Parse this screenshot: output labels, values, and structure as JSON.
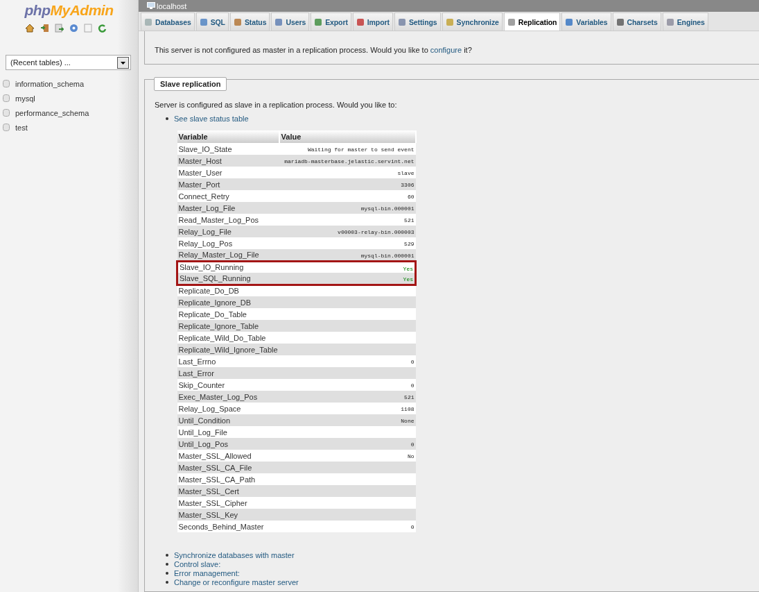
{
  "sidebar": {
    "logo": {
      "part1": "php",
      "part2": "MyAdmin"
    },
    "recent_tables": "(Recent tables) ...",
    "databases": [
      "information_schema",
      "mysql",
      "performance_schema",
      "test"
    ]
  },
  "server": "localhost",
  "tabs": [
    {
      "label": "Databases",
      "selected": false
    },
    {
      "label": "SQL",
      "selected": false
    },
    {
      "label": "Status",
      "selected": false
    },
    {
      "label": "Users",
      "selected": false
    },
    {
      "label": "Export",
      "selected": false
    },
    {
      "label": "Import",
      "selected": false
    },
    {
      "label": "Settings",
      "selected": false
    },
    {
      "label": "Synchronize",
      "selected": false
    },
    {
      "label": "Replication",
      "selected": true
    },
    {
      "label": "Variables",
      "selected": false
    },
    {
      "label": "Charsets",
      "selected": false
    },
    {
      "label": "Engines",
      "selected": false
    }
  ],
  "master": {
    "text": "This server is not configured as master in a replication process. Would you like to ",
    "link": "configure",
    "after": " it?"
  },
  "slave": {
    "legend": "Slave replication",
    "intro": "Server is configured as slave in a replication process. Would you like to:",
    "status_link": "See slave status table",
    "table": {
      "columns": [
        "Variable",
        "Value"
      ],
      "rows": [
        {
          "variable": "Slave_IO_State",
          "value": "Waiting for master to send event",
          "highlighted": false
        },
        {
          "variable": "Master_Host",
          "value": "mariadb-masterbase.jelastic.servint.net",
          "highlighted": false
        },
        {
          "variable": "Master_User",
          "value": "slave",
          "highlighted": false
        },
        {
          "variable": "Master_Port",
          "value": "3306",
          "highlighted": false
        },
        {
          "variable": "Connect_Retry",
          "value": "60",
          "highlighted": false
        },
        {
          "variable": "Master_Log_File",
          "value": "mysql-bin.000001",
          "highlighted": false
        },
        {
          "variable": "Read_Master_Log_Pos",
          "value": "521",
          "highlighted": false
        },
        {
          "variable": "Relay_Log_File",
          "value": "v00003-relay-bin.000003",
          "highlighted": false
        },
        {
          "variable": "Relay_Log_Pos",
          "value": "529",
          "highlighted": false
        },
        {
          "variable": "Relay_Master_Log_File",
          "value": "mysql-bin.000001",
          "highlighted": false
        },
        {
          "variable": "Slave_IO_Running",
          "value": "Yes",
          "highlighted": true
        },
        {
          "variable": "Slave_SQL_Running",
          "value": "Yes",
          "highlighted": true
        },
        {
          "variable": "Replicate_Do_DB",
          "highlighted": false
        },
        {
          "variable": "Replicate_Ignore_DB",
          "highlighted": false
        },
        {
          "variable": "Replicate_Do_Table",
          "highlighted": false
        },
        {
          "variable": "Replicate_Ignore_Table",
          "highlighted": false
        },
        {
          "variable": "Replicate_Wild_Do_Table",
          "highlighted": false
        },
        {
          "variable": "Replicate_Wild_Ignore_Table",
          "highlighted": false
        },
        {
          "variable": "Last_Errno",
          "value": "0",
          "highlighted": false
        },
        {
          "variable": "Last_Error",
          "highlighted": false
        },
        {
          "variable": "Skip_Counter",
          "value": "0",
          "highlighted": false
        },
        {
          "variable": "Exec_Master_Log_Pos",
          "value": "521",
          "highlighted": false
        },
        {
          "variable": "Relay_Log_Space",
          "value": "1108",
          "highlighted": false
        },
        {
          "variable": "Until_Condition",
          "value": "None",
          "highlighted": false
        },
        {
          "variable": "Until_Log_File",
          "highlighted": false
        },
        {
          "variable": "Until_Log_Pos",
          "value": "0",
          "highlighted": false
        },
        {
          "variable": "Master_SSL_Allowed",
          "value": "No",
          "highlighted": false
        },
        {
          "variable": "Master_SSL_CA_File",
          "highlighted": false
        },
        {
          "variable": "Master_SSL_CA_Path",
          "highlighted": false
        },
        {
          "variable": "Master_SSL_Cert",
          "highlighted": false
        },
        {
          "variable": "Master_SSL_Cipher",
          "highlighted": false
        },
        {
          "variable": "Master_SSL_Key",
          "highlighted": false
        },
        {
          "variable": "Seconds_Behind_Master",
          "value": "0",
          "highlighted": false
        }
      ]
    },
    "actions": [
      "Synchronize databases with master",
      "Control slave:",
      "Error management:",
      "Change or reconfigure master server"
    ]
  }
}
